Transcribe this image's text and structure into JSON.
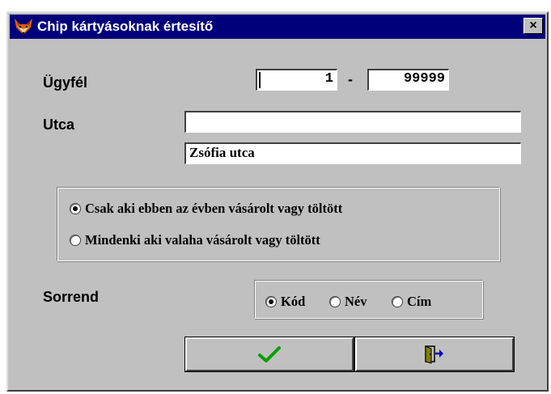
{
  "window": {
    "title": "Chip kártyásoknak értesítő",
    "close_glyph": "×",
    "icon": "fox-head-icon"
  },
  "customer": {
    "label": "Ügyfél",
    "from_value": "1",
    "separator": "-",
    "to_value": "99999"
  },
  "street": {
    "label": "Utca",
    "input_value": "",
    "selected_value": "Zsófia utca"
  },
  "purchase_filter": {
    "options": [
      {
        "label": "Csak aki ebben az évben vásárolt vagy töltött",
        "checked": true
      },
      {
        "label": "Mindenki aki valaha vásárolt vagy töltött",
        "checked": false
      }
    ]
  },
  "sort": {
    "label": "Sorrend",
    "options": [
      {
        "label": "Kód",
        "checked": true
      },
      {
        "label": "Név",
        "checked": false
      },
      {
        "label": "Cím",
        "checked": false
      }
    ]
  },
  "buttons": {
    "ok_icon": "checkmark-icon",
    "exit_icon": "exit-door-icon"
  },
  "colors": {
    "titlebar": "#00007b",
    "face": "#c0c0c0",
    "checkmark": "#00a000"
  }
}
